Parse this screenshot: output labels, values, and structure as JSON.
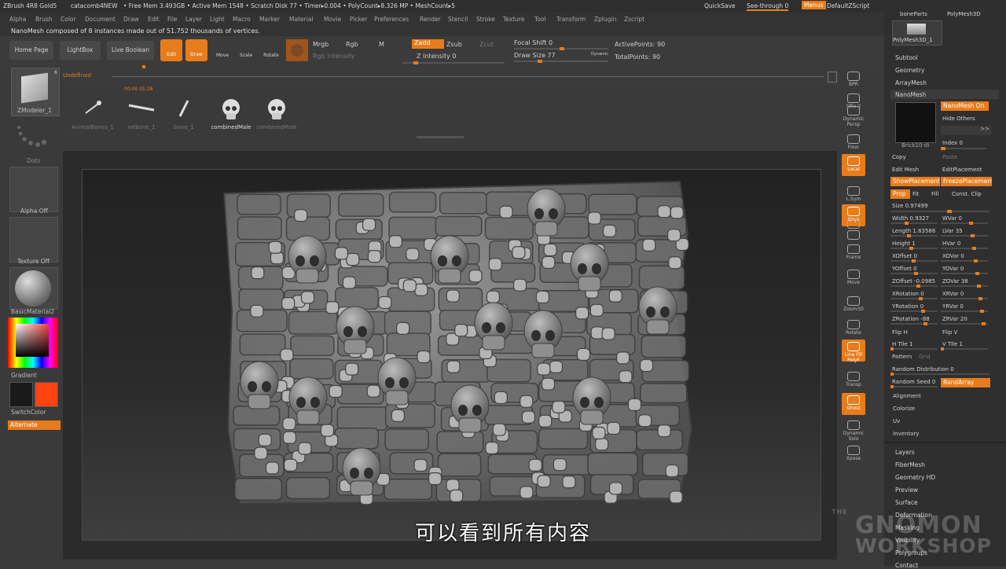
{
  "titlebar": {
    "app": "ZBrush 4R8 Gold5",
    "doc": "catacomb4NEW",
    "freemem": "• Free Mem 3.493GB • Active Mem 1548 • Scratch Disk 77 • Timer▸0.004 • PolyCount▸8.326 MP • MeshCount▸5",
    "quicksave": "QuickSave",
    "seethrough": "See-through  0",
    "menus": "Menus",
    "defaultzscript": "DefaultZScript"
  },
  "menubar": [
    "Alpha",
    "Brush",
    "Color",
    "Document",
    "Draw",
    "Edit",
    "File",
    "Layer",
    "Light",
    "Macro",
    "Marker",
    "Material",
    "Movie",
    "Picker",
    "Preferences",
    "Render",
    "Stencil",
    "Stroke",
    "Texture",
    "Tool",
    "Transform",
    "Zplugin",
    "Zscript"
  ],
  "info": "NanoMesh composed of 8 instances made out of 51.752 thousands of vertices.",
  "toolbar": {
    "home": "Home Page",
    "lightbox": "LightBox",
    "liveboolean": "Live Boolean",
    "edit": "Edit",
    "draw": "Draw",
    "move": "Move",
    "scale": "Scale",
    "rotate": "Rotate",
    "mrgb": "Mrgb",
    "rgb": "Rgb",
    "m": "M",
    "rgb_intensity": "Rgb Intensity",
    "zadd": "Zadd",
    "zsub": "Zsub",
    "zcut": "Zcut",
    "z_intensity": "Z Intensity 0",
    "focal_shift": "Focal Shift 0",
    "draw_size": "Draw Size 77",
    "dynamic": "Dynamic",
    "active_points": "ActivePoints: 90",
    "total_points": "TotalPoints: 90"
  },
  "timeline": {
    "label": "Undefined",
    "time": "00:00 01:28"
  },
  "subtools": [
    {
      "icon": "pin-icon",
      "label": "AnimalBones_1"
    },
    {
      "icon": "bone-icon",
      "label": "ratbone_1"
    },
    {
      "icon": "stick-icon",
      "label": "bone_1"
    },
    {
      "icon": "skull-icon",
      "label": "combinedMale"
    },
    {
      "icon": "skull-icon",
      "label": "combinedMale"
    }
  ],
  "left": {
    "tool": "ZModeler_1",
    "tool_count": "6",
    "dots": "Dots",
    "alpha": "Alpha Off",
    "texture": "Texture Off",
    "material": "BasicMaterial2",
    "gradient": "Gradient",
    "switchcolor": "SwitchColor",
    "alternate": "Alternate",
    "colors": {
      "primary": "#1a1a1a",
      "secondary": "#ff4412"
    }
  },
  "right": [
    {
      "icon": "bpr-icon",
      "label": "BPR"
    },
    {
      "icon": "spix-icon",
      "label": "SPix 3"
    },
    {
      "icon": "dynamic-persp-icon",
      "label": "Dynamic Persp"
    },
    {
      "icon": "floor-icon",
      "label": "Floor"
    },
    {
      "icon": "local-icon",
      "label": "Local"
    },
    {
      "icon": "xyz-axis-icon",
      "label": "L.Sym"
    },
    {
      "icon": "qxyz-icon",
      "label": "Qxyz"
    },
    {
      "icon": "rotate-y-icon",
      "label": ""
    },
    {
      "icon": "rotate-z-icon",
      "label": ""
    },
    {
      "icon": "frame-icon",
      "label": "Frame"
    },
    {
      "icon": "move-hand-icon",
      "label": "Move"
    },
    {
      "icon": "zoom3d-icon",
      "label": "Zoom3D"
    },
    {
      "icon": "rotate-icon",
      "label": "Rotate"
    },
    {
      "icon": "line-fill-icon",
      "label": "Line Fill PolyF"
    },
    {
      "icon": "transp-icon",
      "label": "Transp"
    },
    {
      "icon": "ghost-icon",
      "label": "Ghost"
    },
    {
      "icon": "dynamic-solo-icon",
      "label": "Dynamic Solo"
    },
    {
      "icon": "xpose-icon",
      "label": "Xpose"
    }
  ],
  "palette": {
    "top_labels": [
      "boneParts",
      "PolyMesh3D"
    ],
    "polymesh": "PolyMesh3D_1",
    "sections": [
      "Subtool",
      "Geometry",
      "ArrayMesh",
      "NanoMesh"
    ],
    "nanomesh_on": "NanoMesh On",
    "hide_others": "Hide Others",
    "brick": "Brick10-di",
    "index": "Index 0",
    "copy": "Copy",
    "paste": "Paste",
    "edit_mesh": "Edit Mesh",
    "edit_placement": "EditPlacement",
    "show_placement": "ShowPlacement",
    "freeze_placement": "FreezePlacement",
    "tabs": [
      "Prop",
      "Fit",
      "Fill",
      "Const. Clip"
    ],
    "size": "Size 0.97499",
    "params": [
      [
        "Width 0.9327",
        "WVar 0"
      ],
      [
        "Length 1.83586",
        "LVar 35"
      ],
      [
        "Height 1",
        "HVar 0"
      ],
      [
        "XOffset 0",
        "XOVar 0"
      ],
      [
        "YOffset 0",
        "YOVar 0"
      ],
      [
        "ZOffset -0.0985",
        "ZOVar 38"
      ],
      [
        "XRotation 0",
        "XRVar 0"
      ],
      [
        "YRotation 0",
        "YRVar 0"
      ],
      [
        "ZRotation -88",
        "ZRVar 20"
      ]
    ],
    "flip_h": "Flip H",
    "flip_v": "Flip V",
    "h_tile": "H Tile 1",
    "v_tile": "V Tile 1",
    "pattern": "Pattern",
    "grid": "Grid",
    "random_distribution": "Random Distribution 0",
    "random_seed": "Random Seed 0",
    "rand_array": "RandArray",
    "bottom": [
      "Alignment",
      "Colorize",
      "Uv",
      "Inventory"
    ],
    "more": [
      "Layers",
      "FiberMesh",
      "Geometry HD",
      "Preview",
      "Surface",
      "Deformation",
      "Masking",
      "Visibility",
      "Polygroups",
      "Contact"
    ]
  },
  "subtitle": "可以看到所有内容",
  "watermark": [
    "THE",
    "GNOMON",
    "WORKSHOP"
  ]
}
